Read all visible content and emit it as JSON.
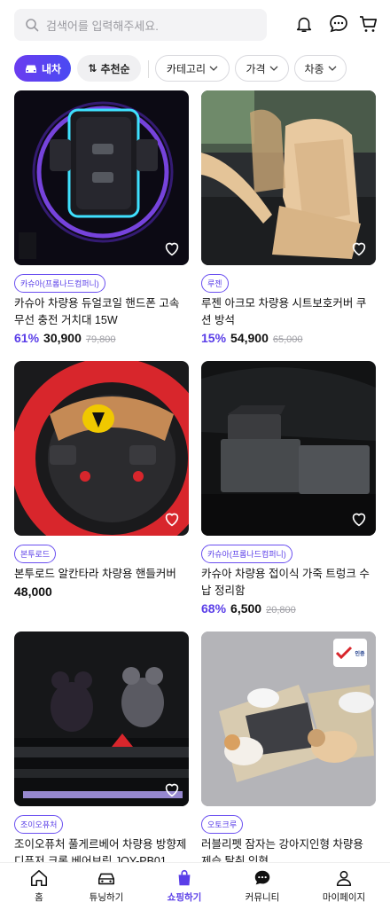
{
  "search": {
    "placeholder": "검색어를 입력해주세요."
  },
  "header_icons": [
    "bell-icon",
    "chat-icon",
    "cart-icon"
  ],
  "filters": {
    "category_chip": "내차",
    "sort": "추천순",
    "category": "카테고리",
    "price": "가격",
    "car_type": "차종"
  },
  "products": [
    {
      "tag": "카슈아(프롬나드컴퍼니)",
      "title": "카슈아 차량용 듀얼코일 핸드폰 고속 무선 충전 거치대 15W",
      "discount": "61%",
      "price": "30,900",
      "original": "79,800"
    },
    {
      "tag": "루젠",
      "title": "루젠 아크모 차량용 시트보호커버 쿠션 방석",
      "discount": "15%",
      "price": "54,900",
      "original": "65,000"
    },
    {
      "tag": "본투로드",
      "title": "본투로드 알칸타라 차량용 핸들커버",
      "discount": "",
      "price": "48,000",
      "original": ""
    },
    {
      "tag": "카슈아(프롬나드컴퍼니)",
      "title": "카슈아 차량용 접이식 가죽 트렁크 수납 정리함",
      "discount": "68%",
      "price": "6,500",
      "original": "20,800"
    },
    {
      "tag": "조이오퓨처",
      "title": "조이오퓨처 풀게르베어 차량용 방향제 디퓨저 크롬 베어브릭 JOY-PB01",
      "discount": "",
      "price": "",
      "original": ""
    },
    {
      "tag": "오토크루",
      "title": "러블리펫 잠자는 강아지인형 차량용 제습 탈취 인형",
      "discount": "",
      "price": "",
      "original": ""
    }
  ],
  "badge_text": "인증",
  "colors": {
    "accent": "#5a3ee8",
    "accent_gradient_start": "#6b3cf0"
  },
  "tabs": [
    {
      "label": "홈",
      "icon": "home-icon"
    },
    {
      "label": "튜닝하기",
      "icon": "car-icon"
    },
    {
      "label": "쇼핑하기",
      "icon": "shopping-bag-icon",
      "active": true
    },
    {
      "label": "커뮤니티",
      "icon": "community-chat-icon"
    },
    {
      "label": "마이페이지",
      "icon": "person-icon"
    }
  ]
}
